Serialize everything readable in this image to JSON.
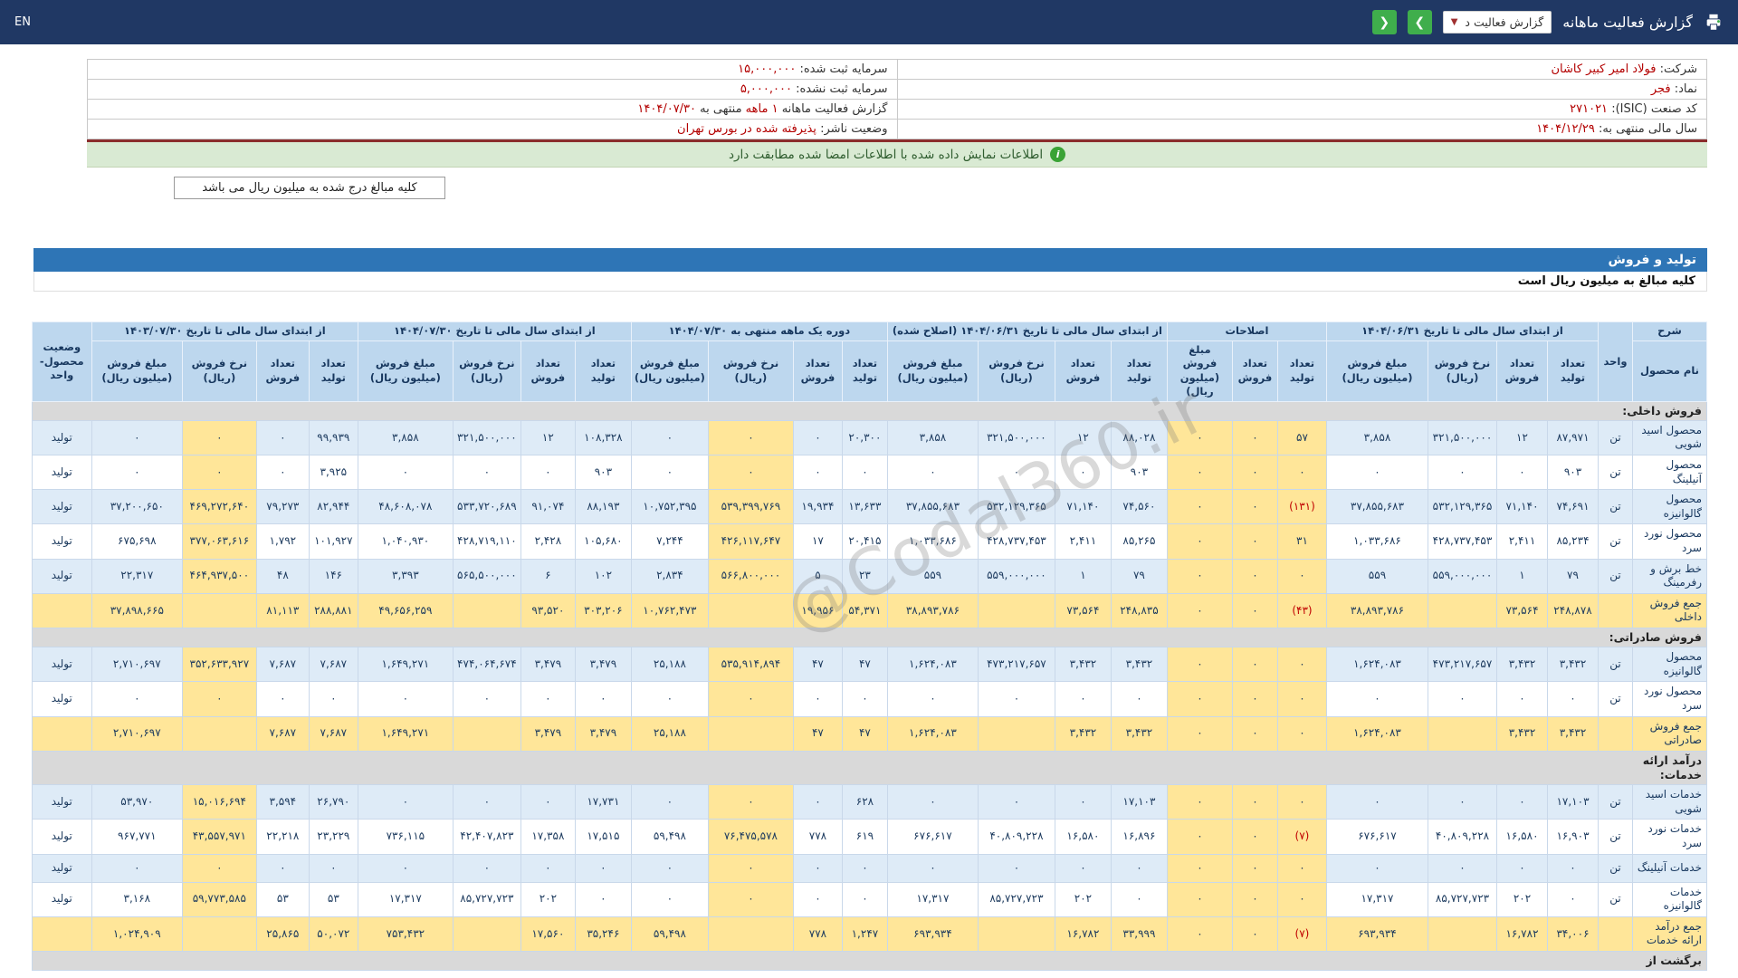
{
  "topbar": {
    "title": "گزارش فعالیت ماهانه",
    "report_select_value": "گزارش فعالیت د",
    "caret": "▼",
    "arrow_right": "❯",
    "arrow_left": "❮",
    "lang_toggle": "EN"
  },
  "colors": {
    "topbar_bg": "#203864",
    "nav_button_green": "#3fae4c",
    "banner_bg": "#d9ead3",
    "section_bar_blue": "#2e75b6",
    "table_header_blue": "#bdd7ee",
    "row_blue": "#deebf7",
    "highlight_yellow": "#ffe699",
    "section_gray": "#d9d9d9",
    "value_red": "#b30000",
    "separator_maroon": "#8b2d2d"
  },
  "info": {
    "rows": [
      {
        "right": [
          {
            "t": "شرکت:",
            "red": false
          },
          {
            "t": "فولاد امیر کبیر کاشان",
            "red": true
          }
        ],
        "left": [
          {
            "t": "سرمایه ثبت شده:",
            "red": false
          },
          {
            "t": "۱۵,۰۰۰,۰۰۰",
            "red": true
          }
        ]
      },
      {
        "right": [
          {
            "t": "نماد:",
            "red": false
          },
          {
            "t": "فجر",
            "red": true
          }
        ],
        "left": [
          {
            "t": "سرمایه ثبت نشده:",
            "red": false
          },
          {
            "t": "۵,۰۰۰,۰۰۰",
            "red": true
          }
        ]
      },
      {
        "right": [
          {
            "t": "کد صنعت (ISIC):",
            "red": false
          },
          {
            "t": "۲۷۱۰۲۱",
            "red": true
          }
        ],
        "left": [
          {
            "t": "گزارش فعالیت ماهانه",
            "red": false
          },
          {
            "t": "۱ ماهه",
            "red": true
          },
          {
            "t": "منتهی به",
            "red": false
          },
          {
            "t": "۱۴۰۴/۰۷/۳۰",
            "red": true
          }
        ]
      },
      {
        "right": [
          {
            "t": "سال مالی منتهی به:",
            "red": false
          },
          {
            "t": "۱۴۰۴/۱۲/۲۹",
            "red": true
          }
        ],
        "left": [
          {
            "t": "وضعیت ناشر:",
            "red": false
          },
          {
            "t": "پذیرفته شده در بورس تهران",
            "red": true
          }
        ]
      }
    ]
  },
  "banner": {
    "icon_glyph": "i",
    "text": "اطلاعات نمایش داده شده با اطلاعات امضا شده مطابقت دارد"
  },
  "notes": {
    "amounts_note": "کلیه مبالغ درج شده به میلیون ریال می باشد"
  },
  "section": {
    "title": "تولید و فروش",
    "subtitle": "کلیه مبالغ به میلیون ریال است"
  },
  "watermark": "@Codal360.ir",
  "table": {
    "header": {
      "desc_top": "شرح",
      "desc_bottom": "نام محصول",
      "unit": "واحد",
      "status": "وضعیت محصول-واحد",
      "groups": [
        {
          "label": "از ابتدای سال مالی تا تاریخ ۱۴۰۴/۰۶/۳۱",
          "cols": [
            "تعداد تولید",
            "تعداد فروش",
            "نرخ فروش (ریال)",
            "مبلغ فروش (میلیون ریال)"
          ]
        },
        {
          "label": "اصلاحات",
          "cols": [
            "تعداد تولید",
            "تعداد فروش",
            "مبلغ فروش (میلیون ریال)"
          ]
        },
        {
          "label": "از ابتدای سال مالی تا تاریخ ۱۴۰۴/۰۶/۳۱ (اصلاح شده)",
          "cols": [
            "تعداد تولید",
            "تعداد فروش",
            "نرخ فروش (ریال)",
            "مبلغ فروش (میلیون ریال)"
          ]
        },
        {
          "label": "دوره یک ماهه منتهی به ۱۴۰۴/۰۷/۳۰",
          "cols": [
            "تعداد تولید",
            "تعداد فروش",
            "نرخ فروش (ریال)",
            "مبلغ فروش (میلیون ریال)"
          ]
        },
        {
          "label": "از ابتدای سال مالی تا تاریخ ۱۴۰۴/۰۷/۳۰",
          "cols": [
            "تعداد تولید",
            "تعداد فروش",
            "نرخ فروش (ریال)",
            "مبلغ فروش (میلیون ریال)"
          ]
        },
        {
          "label": "از ابتدای سال مالی تا تاریخ ۱۴۰۳/۰۷/۳۰",
          "cols": [
            "تعداد تولید",
            "تعداد فروش",
            "نرخ فروش (ریال)",
            "مبلغ فروش (میلیون ریال)"
          ]
        }
      ]
    },
    "rows": [
      {
        "type": "section",
        "label": "فروش داخلی:"
      },
      {
        "type": "data",
        "name": "محصول اسید شویی",
        "unit": "تن",
        "status": "تولید",
        "cells": [
          "۸۷,۹۷۱",
          "۱۲",
          "۳۲۱,۵۰۰,۰۰۰",
          "۳,۸۵۸",
          "۵۷",
          "۰",
          "۰",
          "۸۸,۰۲۸",
          "۱۲",
          "۳۲۱,۵۰۰,۰۰۰",
          "۳,۸۵۸",
          "۲۰,۳۰۰",
          "۰",
          "۰",
          "۰",
          "۱۰۸,۳۲۸",
          "۱۲",
          "۳۲۱,۵۰۰,۰۰۰",
          "۳,۸۵۸",
          "۹۹,۹۳۹",
          "۰",
          "۰",
          "۰"
        ]
      },
      {
        "type": "data",
        "name": "محصول آنیلینگ",
        "unit": "تن",
        "status": "تولید",
        "cells": [
          "۹۰۳",
          "۰",
          "۰",
          "۰",
          "۰",
          "۰",
          "۰",
          "۹۰۳",
          "۰",
          "۰",
          "۰",
          "۰",
          "۰",
          "۰",
          "۰",
          "۹۰۳",
          "۰",
          "۰",
          "۰",
          "۳,۹۲۵",
          "۰",
          "۰",
          "۰"
        ]
      },
      {
        "type": "data",
        "name": "محصول گالوانیزه",
        "unit": "تن",
        "status": "تولید",
        "cells": [
          "۷۴,۶۹۱",
          "۷۱,۱۴۰",
          "۵۳۲,۱۲۹,۳۶۵",
          "۳۷,۸۵۵,۶۸۳",
          "(۱۳۱)",
          "۰",
          "۰",
          "۷۴,۵۶۰",
          "۷۱,۱۴۰",
          "۵۳۲,۱۲۹,۳۶۵",
          "۳۷,۸۵۵,۶۸۳",
          "۱۳,۶۳۳",
          "۱۹,۹۳۴",
          "۵۳۹,۳۹۹,۷۶۹",
          "۱۰,۷۵۲,۳۹۵",
          "۸۸,۱۹۳",
          "۹۱,۰۷۴",
          "۵۳۳,۷۲۰,۶۸۹",
          "۴۸,۶۰۸,۰۷۸",
          "۸۲,۹۴۴",
          "۷۹,۲۷۳",
          "۴۶۹,۲۷۲,۶۴۰",
          "۳۷,۲۰۰,۶۵۰"
        ]
      },
      {
        "type": "data",
        "name": "محصول نورد سرد",
        "unit": "تن",
        "status": "تولید",
        "cells": [
          "۸۵,۲۳۴",
          "۲,۴۱۱",
          "۴۲۸,۷۳۷,۴۵۳",
          "۱,۰۳۳,۶۸۶",
          "۳۱",
          "۰",
          "۰",
          "۸۵,۲۶۵",
          "۲,۴۱۱",
          "۴۲۸,۷۳۷,۴۵۳",
          "۱,۰۳۳,۶۸۶",
          "۲۰,۴۱۵",
          "۱۷",
          "۴۲۶,۱۱۷,۶۴۷",
          "۷,۲۴۴",
          "۱۰۵,۶۸۰",
          "۲,۴۲۸",
          "۴۲۸,۷۱۹,۱۱۰",
          "۱,۰۴۰,۹۳۰",
          "۱۰۱,۹۲۷",
          "۱,۷۹۲",
          "۳۷۷,۰۶۳,۶۱۶",
          "۶۷۵,۶۹۸"
        ]
      },
      {
        "type": "data",
        "name": "خط برش و رفرمینگ",
        "unit": "تن",
        "status": "تولید",
        "cells": [
          "۷۹",
          "۱",
          "۵۵۹,۰۰۰,۰۰۰",
          "۵۵۹",
          "۰",
          "۰",
          "۰",
          "۷۹",
          "۱",
          "۵۵۹,۰۰۰,۰۰۰",
          "۵۵۹",
          "۲۳",
          "۵",
          "۵۶۶,۸۰۰,۰۰۰",
          "۲,۸۳۴",
          "۱۰۲",
          "۶",
          "۵۶۵,۵۰۰,۰۰۰",
          "۳,۳۹۳",
          "۱۴۶",
          "۴۸",
          "۴۶۴,۹۳۷,۵۰۰",
          "۲۲,۳۱۷"
        ]
      },
      {
        "type": "sum",
        "name": "جمع فروش داخلی",
        "unit": "",
        "status": "",
        "cells": [
          "۲۴۸,۸۷۸",
          "۷۳,۵۶۴",
          "",
          "۳۸,۸۹۳,۷۸۶",
          "(۴۳)",
          "۰",
          "۰",
          "۲۴۸,۸۳۵",
          "۷۳,۵۶۴",
          "",
          "۳۸,۸۹۳,۷۸۶",
          "۵۴,۳۷۱",
          "۱۹,۹۵۶",
          "",
          "۱۰,۷۶۲,۴۷۳",
          "۳۰۳,۲۰۶",
          "۹۳,۵۲۰",
          "",
          "۴۹,۶۵۶,۲۵۹",
          "۲۸۸,۸۸۱",
          "۸۱,۱۱۳",
          "",
          "۳۷,۸۹۸,۶۶۵"
        ]
      },
      {
        "type": "section",
        "label": "فروش صادراتی:"
      },
      {
        "type": "data",
        "name": "محصول گالوانیزه",
        "unit": "تن",
        "status": "تولید",
        "cells": [
          "۳,۴۳۲",
          "۳,۴۳۲",
          "۴۷۳,۲۱۷,۶۵۷",
          "۱,۶۲۴,۰۸۳",
          "۰",
          "۰",
          "۰",
          "۳,۴۳۲",
          "۳,۴۳۲",
          "۴۷۳,۲۱۷,۶۵۷",
          "۱,۶۲۴,۰۸۳",
          "۴۷",
          "۴۷",
          "۵۳۵,۹۱۴,۸۹۴",
          "۲۵,۱۸۸",
          "۳,۴۷۹",
          "۳,۴۷۹",
          "۴۷۴,۰۶۴,۶۷۴",
          "۱,۶۴۹,۲۷۱",
          "۷,۶۸۷",
          "۷,۶۸۷",
          "۳۵۲,۶۳۳,۹۲۷",
          "۲,۷۱۰,۶۹۷"
        ]
      },
      {
        "type": "data",
        "name": "محصول نورد سرد",
        "unit": "تن",
        "status": "تولید",
        "cells": [
          "۰",
          "۰",
          "۰",
          "۰",
          "۰",
          "۰",
          "۰",
          "۰",
          "۰",
          "۰",
          "۰",
          "۰",
          "۰",
          "۰",
          "۰",
          "۰",
          "۰",
          "۰",
          "۰",
          "۰",
          "۰",
          "۰",
          "۰"
        ]
      },
      {
        "type": "sum",
        "name": "جمع فروش صادراتی",
        "unit": "",
        "status": "",
        "cells": [
          "۳,۴۳۲",
          "۳,۴۳۲",
          "",
          "۱,۶۲۴,۰۸۳",
          "۰",
          "۰",
          "۰",
          "۳,۴۳۲",
          "۳,۴۳۲",
          "",
          "۱,۶۲۴,۰۸۳",
          "۴۷",
          "۴۷",
          "",
          "۲۵,۱۸۸",
          "۳,۴۷۹",
          "۳,۴۷۹",
          "",
          "۱,۶۴۹,۲۷۱",
          "۷,۶۸۷",
          "۷,۶۸۷",
          "",
          "۲,۷۱۰,۶۹۷"
        ]
      },
      {
        "type": "section",
        "label": "درآمد ارائه خدمات:"
      },
      {
        "type": "data",
        "name": "خدمات اسید شویی",
        "unit": "تن",
        "status": "تولید",
        "cells": [
          "۱۷,۱۰۳",
          "۰",
          "۰",
          "۰",
          "۰",
          "۰",
          "۰",
          "۱۷,۱۰۳",
          "۰",
          "۰",
          "۰",
          "۶۲۸",
          "۰",
          "۰",
          "۰",
          "۱۷,۷۳۱",
          "۰",
          "۰",
          "۰",
          "۲۶,۷۹۰",
          "۳,۵۹۴",
          "۱۵,۰۱۶,۶۹۴",
          "۵۳,۹۷۰"
        ]
      },
      {
        "type": "data",
        "name": "خدمات نورد سرد",
        "unit": "تن",
        "status": "تولید",
        "cells": [
          "۱۶,۹۰۳",
          "۱۶,۵۸۰",
          "۴۰,۸۰۹,۲۲۸",
          "۶۷۶,۶۱۷",
          "(۷)",
          "۰",
          "۰",
          "۱۶,۸۹۶",
          "۱۶,۵۸۰",
          "۴۰,۸۰۹,۲۲۸",
          "۶۷۶,۶۱۷",
          "۶۱۹",
          "۷۷۸",
          "۷۶,۴۷۵,۵۷۸",
          "۵۹,۴۹۸",
          "۱۷,۵۱۵",
          "۱۷,۳۵۸",
          "۴۲,۴۰۷,۸۲۳",
          "۷۳۶,۱۱۵",
          "۲۳,۲۲۹",
          "۲۲,۲۱۸",
          "۴۳,۵۵۷,۹۷۱",
          "۹۶۷,۷۷۱"
        ]
      },
      {
        "type": "data",
        "name": "خدمات آنیلینگ",
        "unit": "تن",
        "status": "تولید",
        "cells": [
          "۰",
          "۰",
          "۰",
          "۰",
          "۰",
          "۰",
          "۰",
          "۰",
          "۰",
          "۰",
          "۰",
          "۰",
          "۰",
          "۰",
          "۰",
          "۰",
          "۰",
          "۰",
          "۰",
          "۰",
          "۰",
          "۰",
          "۰"
        ]
      },
      {
        "type": "data",
        "name": "خدمات گالوانیزه",
        "unit": "تن",
        "status": "تولید",
        "cells": [
          "۰",
          "۲۰۲",
          "۸۵,۷۲۷,۷۲۳",
          "۱۷,۳۱۷",
          "۰",
          "۰",
          "۰",
          "۰",
          "۲۰۲",
          "۸۵,۷۲۷,۷۲۳",
          "۱۷,۳۱۷",
          "۰",
          "۰",
          "۰",
          "۰",
          "۰",
          "۲۰۲",
          "۸۵,۷۲۷,۷۲۳",
          "۱۷,۳۱۷",
          "۵۳",
          "۵۳",
          "۵۹,۷۷۳,۵۸۵",
          "۳,۱۶۸"
        ]
      },
      {
        "type": "sum",
        "name": "جمع درآمد ارائه خدمات",
        "unit": "",
        "status": "",
        "cells": [
          "۳۴,۰۰۶",
          "۱۶,۷۸۲",
          "",
          "۶۹۳,۹۳۴",
          "(۷)",
          "۰",
          "۰",
          "۳۳,۹۹۹",
          "۱۶,۷۸۲",
          "",
          "۶۹۳,۹۳۴",
          "۱,۲۴۷",
          "۷۷۸",
          "",
          "۵۹,۴۹۸",
          "۳۵,۲۴۶",
          "۱۷,۵۶۰",
          "",
          "۷۵۳,۴۳۲",
          "۵۰,۰۷۲",
          "۲۵,۸۶۵",
          "",
          "۱,۰۲۴,۹۰۹"
        ]
      },
      {
        "type": "section",
        "label": "برگشت از"
      }
    ]
  }
}
